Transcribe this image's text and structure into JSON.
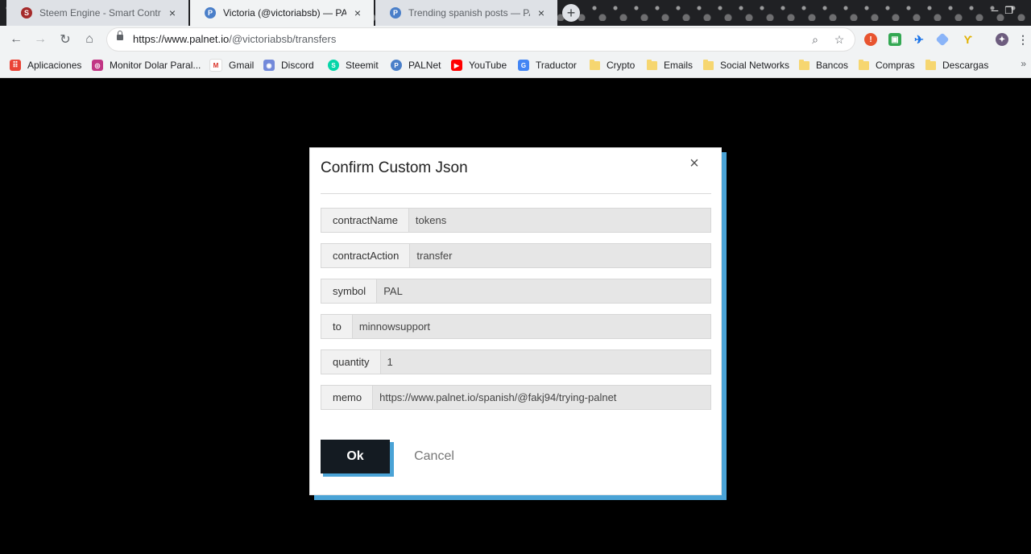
{
  "browser": {
    "tabs": [
      {
        "title": "Steem Engine - Smart Contracts",
        "icon": "steem-engine-icon",
        "active": false
      },
      {
        "title": "Victoria (@victoriabsb) — PALNet",
        "icon": "palnet-icon",
        "active": true
      },
      {
        "title": "Trending spanish posts — PALNet",
        "icon": "palnet-icon",
        "active": false
      }
    ],
    "new_tab_glyph": "+",
    "url_host": "https://www.palnet.io",
    "url_path": "/@victoriabsb/transfers",
    "bookmarks": [
      {
        "label": "Aplicaciones",
        "icon": "apps-grid-icon"
      },
      {
        "label": "Monitor Dolar Paral...",
        "icon": "instagram-icon"
      },
      {
        "label": "Gmail",
        "icon": "gmail-icon"
      },
      {
        "label": "Discord",
        "icon": "discord-icon"
      },
      {
        "label": "Steemit",
        "icon": "steemit-icon"
      },
      {
        "label": "PALNet",
        "icon": "palnet-icon"
      },
      {
        "label": "YouTube",
        "icon": "youtube-icon"
      },
      {
        "label": "Traductor",
        "icon": "translate-icon"
      },
      {
        "label": "Crypto",
        "icon": "folder-icon"
      },
      {
        "label": "Emails",
        "icon": "folder-icon"
      },
      {
        "label": "Social Networks",
        "icon": "folder-icon"
      },
      {
        "label": "Bancos",
        "icon": "folder-icon"
      },
      {
        "label": "Compras",
        "icon": "folder-icon"
      },
      {
        "label": "Descargas",
        "icon": "folder-icon"
      }
    ],
    "bookmarks_more": "»"
  },
  "modal": {
    "title": "Confirm Custom Json",
    "close_glyph": "×",
    "fields": [
      {
        "key": "contractName",
        "value": "tokens"
      },
      {
        "key": "contractAction",
        "value": "transfer"
      },
      {
        "key": "symbol",
        "value": "PAL"
      },
      {
        "key": "to",
        "value": "minnowsupport"
      },
      {
        "key": "quantity",
        "value": "1"
      },
      {
        "key": "memo",
        "value": "https://www.palnet.io/spanish/@fakj94/trying-palnet"
      }
    ],
    "ok_label": "Ok",
    "cancel_label": "Cancel"
  },
  "colors": {
    "accent": "#4aa3d6",
    "ok_button": "#141b22",
    "overlay": "#000000"
  }
}
